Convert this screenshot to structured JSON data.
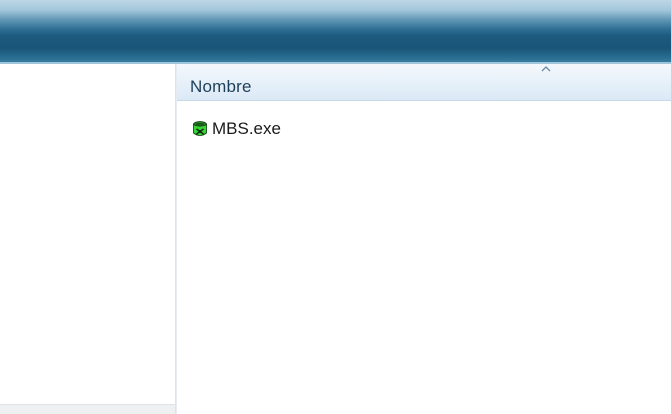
{
  "content": {
    "columns": [
      {
        "label": "Nombre",
        "sort": "ascending"
      }
    ],
    "files": [
      {
        "name": "MBS.exe",
        "icon": "green-app-icon"
      }
    ]
  },
  "colors": {
    "titlebar": "#1c5a7e",
    "header_text": "#1e3f5a",
    "icon_green": "#2fcf2f"
  }
}
